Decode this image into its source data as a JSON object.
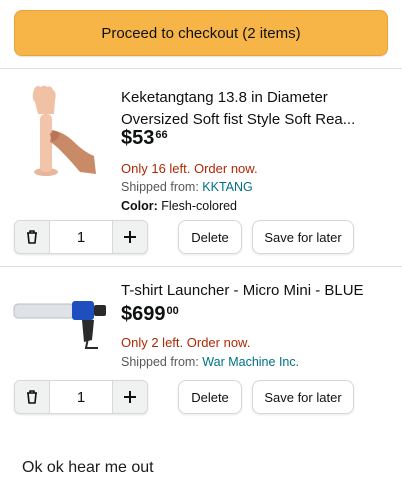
{
  "checkout": {
    "label": "Proceed to checkout (2 items)"
  },
  "items": [
    {
      "title": "Keketangtang 13.8 in Diameter Oversized Soft fist Style Soft Rea...",
      "price_whole": "$53",
      "price_fraction": "66",
      "stock": "Only 16 left. Order now.",
      "shipped_label": "Shipped from: ",
      "shipped_seller": "KKTANG",
      "color_label": "Color: ",
      "color_value": "Flesh-colored",
      "quantity": "1",
      "delete_label": "Delete",
      "save_label": "Save for later"
    },
    {
      "title": "T-shirt Launcher - Micro Mini - BLUE",
      "price_whole": "$699",
      "price_fraction": "00",
      "stock": "Only 2 left. Order now.",
      "shipped_label": "Shipped from: ",
      "shipped_seller": "War Machine Inc.",
      "quantity": "1",
      "delete_label": "Delete",
      "save_label": "Save for later"
    }
  ],
  "caption": "Ok ok hear me out",
  "colors": {
    "checkout_bg": "#f7b547",
    "stock_red": "#b12704",
    "link_teal": "#007185",
    "launcher_blue": "#1f4fbf"
  },
  "icons": {
    "trash": "trash-icon",
    "plus": "plus-icon"
  }
}
